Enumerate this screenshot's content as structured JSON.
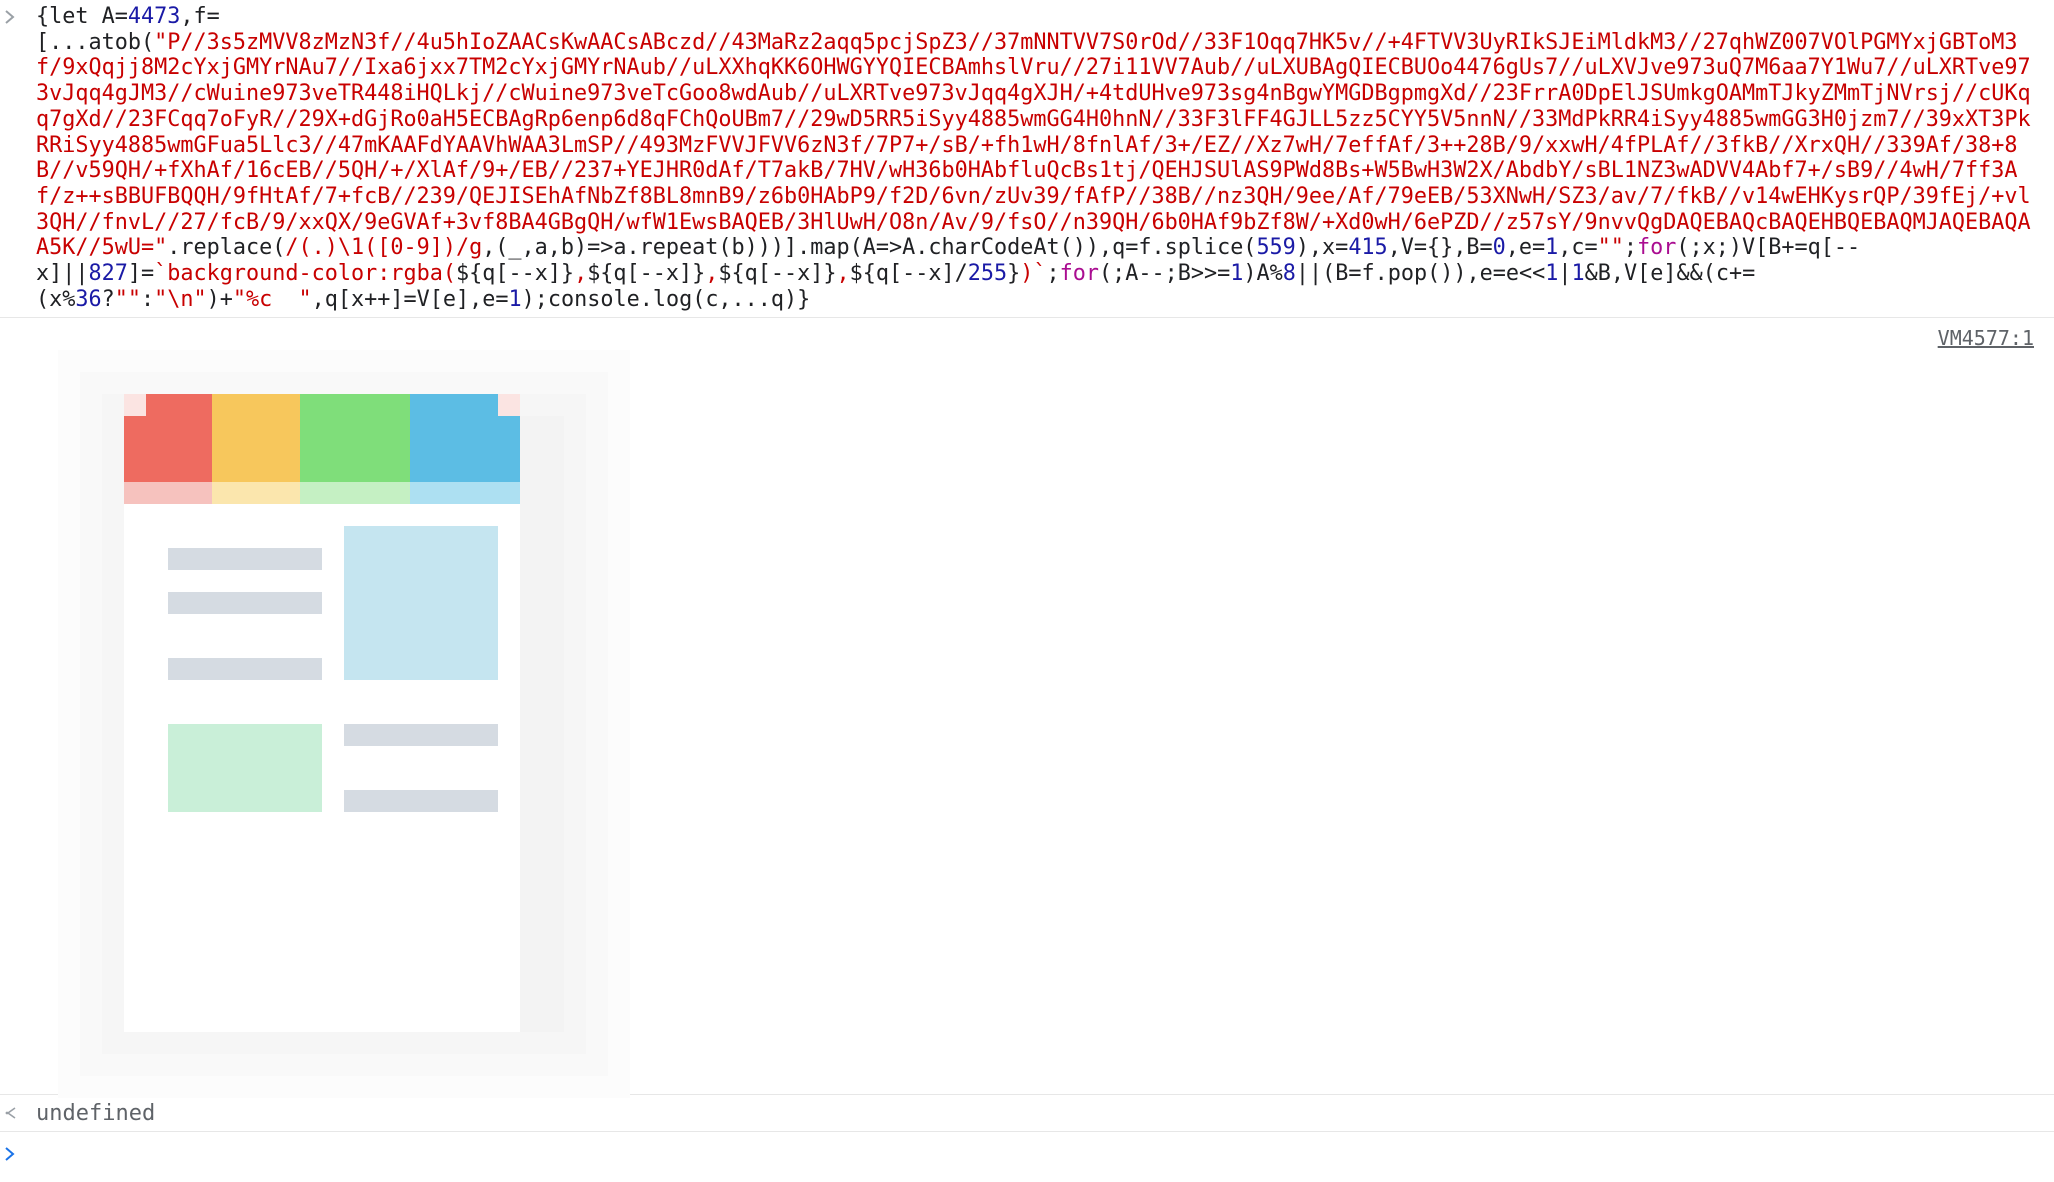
{
  "console": {
    "input_prompt_icon": "chevron-right-icon",
    "result_icon": "return-arrow-icon",
    "code_segments": [
      {
        "t": "{let A=",
        "c": "p"
      },
      {
        "t": "4473",
        "c": "num"
      },
      {
        "t": ",f=\n[...atob(",
        "c": "p"
      },
      {
        "t": "\"P//3s5zMVV8zMzN3f//4u5hIoZAACsKwAACsABczd//43MaRz2aqq5pcjSpZ3//37mNNTVV7S0rOd//33F1Oqq7HK5v//+4FTVV3UyRIkSJEiMldkM3//27qhWZ007VOlPGMYxjGBToM3f/9xQqjj8M2cYxjGMYrNAu7//Ixa6jxx7TM2cYxjGMYrNAub//uLXXhqKK6OHWGYYQIECBAmhslVru//27i11VV7Aub//uLXUBAgQIECBUOo4476gUs7//uLXVJve973uQ7M6aa7Y1Wu7//uLXRTve973vJqq4gJM3//cWuine973veTR448iHQLkj//cWuine973veTcGoo8wdAub//uLXRTve973vJqq4gXJH/+4tdUHve973sg4nBgwYMGDBgpmgXd//23FrrA0DpElJSUmkgOAMmTJkyZMmTjNVrsj//cUKqq7gXd//23FCqq7oFyR//29X+dGjRo0aH5ECBAgRp6enp6d8qFChQoUBm7//29wD5RR5iSyy4885wmGG4H0hnN//33F3lFF4GJLL5zz5CYY5V5nnN//33MdPkRR4iSyy4885wmGG3H0jzm7//39xXT3PkRRiSyy4885wmGFua5Llc3//47mKAAFdYAAVhWAA3LmSP//493MzFVVJFVV6zN3f/7P7+/sB/+fh1wH/8fnlAf/3+/EZ//Xz7wH/7effAf/3++28B/9/xxwH/4fPLAf//3fkB//XrxQH//339Af/38+8B//v59QH/+fXhAf/16cEB//5QH/+/XlAf/9+/EB//237+YEJHR0dAf/T7akB/7HV/wH36b0HAbfluQcBs1tj/QEHJSUlAS9PWd8Bs+W5BwH3W2X/AbdbY/sBL1NZ3wADVV4Abf7+/sB9//4wH/7ff3Af/z++sBBUFBQQH/9fHtAf/7+fcB//239/QEJISEhAfNbZf8BL8mnB9/z6b0HAbP9/f2D/6vn/zUv39/fAfP//38B//nz3QH/9ee/Af/79eEB/53XNwH/SZ3/av/7/fkB//v14wEHKysrQP/39fEj/+vl3QH//fnvL//27/fcB/9/xxQX/9eGVAf+3vf8BA4GBgQH/wfW1EwsBAQEB/3HlUwH/O8n/Av/9/fsO//n39QH/6b0HAf9bZf8W/+Xd0wH/6ePZD//z57sY/9nvvQgDAQEBAQcBAQEHBQEBAQMJAQEBAQAA5K//5wU=\"",
        "c": "str"
      },
      {
        "t": ".replace(",
        "c": "p"
      },
      {
        "t": "/(.)\\1([0-9])/g",
        "c": "str"
      },
      {
        "t": ",(_,a,b)=>a.repeat(b)))].map(A=>A.charCodeAt()),q=f.splice(",
        "c": "p"
      },
      {
        "t": "559",
        "c": "num"
      },
      {
        "t": "),x=",
        "c": "p"
      },
      {
        "t": "415",
        "c": "num"
      },
      {
        "t": ",V={},B=",
        "c": "p"
      },
      {
        "t": "0",
        "c": "num"
      },
      {
        "t": ",e=",
        "c": "p"
      },
      {
        "t": "1",
        "c": "num"
      },
      {
        "t": ",c=",
        "c": "p"
      },
      {
        "t": "\"\"",
        "c": "str"
      },
      {
        "t": ";",
        "c": "p"
      },
      {
        "t": "for",
        "c": "kw"
      },
      {
        "t": "(;x;)V[B+=q[--\nx]||",
        "c": "p"
      },
      {
        "t": "827",
        "c": "num"
      },
      {
        "t": "]=",
        "c": "p"
      },
      {
        "t": "`background-color:rgba(",
        "c": "str"
      },
      {
        "t": "${q[--x]}",
        "c": "p"
      },
      {
        "t": ",",
        "c": "str"
      },
      {
        "t": "${q[--x]}",
        "c": "p"
      },
      {
        "t": ",",
        "c": "str"
      },
      {
        "t": "${q[--x]}",
        "c": "p"
      },
      {
        "t": ",",
        "c": "str"
      },
      {
        "t": "${q[--x]/",
        "c": "p"
      },
      {
        "t": "255",
        "c": "num"
      },
      {
        "t": "}",
        "c": "p"
      },
      {
        "t": ")`",
        "c": "str"
      },
      {
        "t": ";",
        "c": "p"
      },
      {
        "t": "for",
        "c": "kw"
      },
      {
        "t": "(;A--;B>>=",
        "c": "p"
      },
      {
        "t": "1",
        "c": "num"
      },
      {
        "t": ")A%",
        "c": "p"
      },
      {
        "t": "8",
        "c": "num"
      },
      {
        "t": "||(B=f.pop()),e=e<<",
        "c": "p"
      },
      {
        "t": "1",
        "c": "num"
      },
      {
        "t": "|",
        "c": "p"
      },
      {
        "t": "1",
        "c": "num"
      },
      {
        "t": "&B,V[e]&&(c+=\n(x%",
        "c": "p"
      },
      {
        "t": "36",
        "c": "num"
      },
      {
        "t": "?",
        "c": "p"
      },
      {
        "t": "\"\"",
        "c": "str"
      },
      {
        "t": ":",
        "c": "p"
      },
      {
        "t": "\"\\n\"",
        "c": "str"
      },
      {
        "t": ")+",
        "c": "p"
      },
      {
        "t": "\"%c  \"",
        "c": "str"
      },
      {
        "t": ",q[x++]=V[e],e=",
        "c": "p"
      },
      {
        "t": "1",
        "c": "num"
      },
      {
        "t": ");console.log(c,...q)}",
        "c": "p"
      }
    ],
    "source_link": "VM4577:1",
    "result_text": "undefined",
    "caret_icon": "chevron-right-icon"
  },
  "artwork": {
    "description_icon": "pixel-art-app-window-icon",
    "palette": {
      "red": "#ee6b60",
      "yellow": "#f7c75c",
      "green": "#7fde7a",
      "blue": "#5cbde4",
      "light_blue": "#c5e5f0",
      "light_green": "#c9efd8",
      "gray": "#d5dbe2",
      "border": "#f0f0f0"
    }
  }
}
